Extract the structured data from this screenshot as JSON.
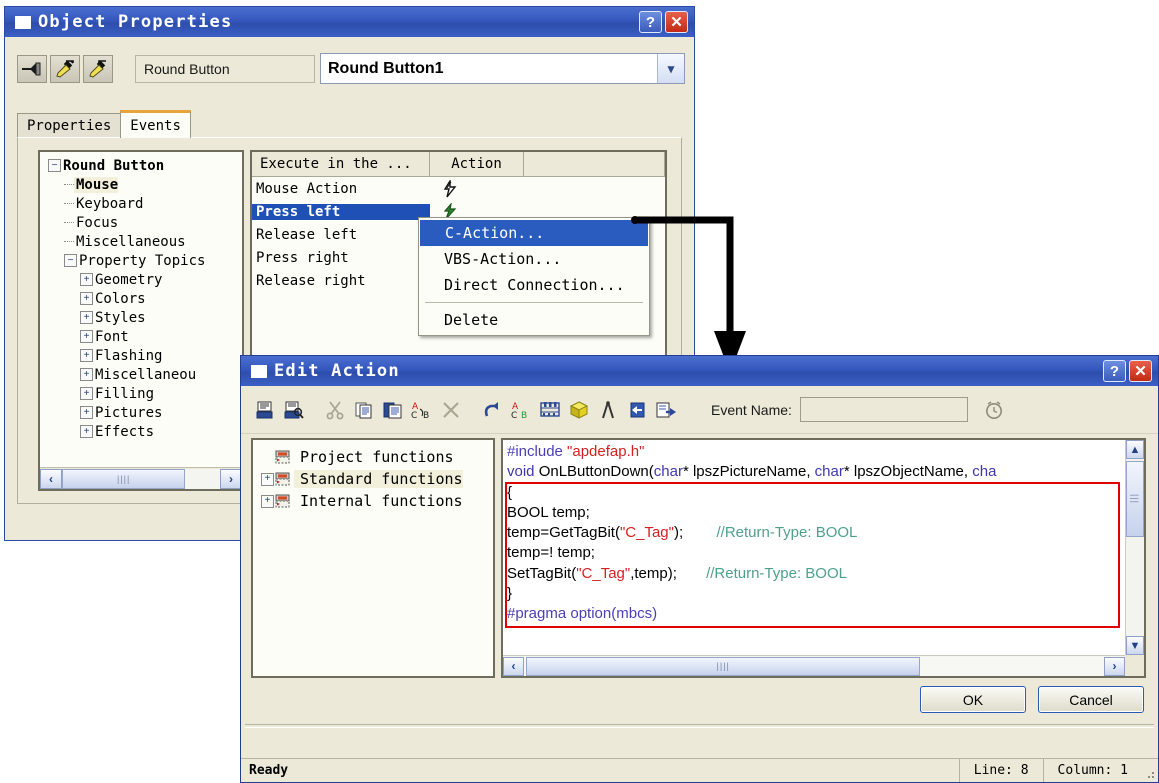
{
  "object_properties": {
    "title": "Object Properties",
    "title_icon": "window-icon",
    "help_label": "?",
    "close_label": "✕",
    "toolbar": [
      {
        "name": "pin-button",
        "icon": "pin-icon"
      },
      {
        "name": "pipette-up-button",
        "icon": "eyedropper-up-icon"
      },
      {
        "name": "pipette-down-button",
        "icon": "eyedropper-down-icon"
      }
    ],
    "object_type_label": "Round Button",
    "object_combo_value": "Round Button1",
    "tabs": [
      {
        "label": "Properties",
        "active": false
      },
      {
        "label": "Events",
        "active": true
      }
    ],
    "tree": [
      {
        "label": "Round Button",
        "indent": 0,
        "toggle": "minus",
        "style": "root"
      },
      {
        "label": "Mouse",
        "indent": 1,
        "toggle": "none",
        "style": "selected"
      },
      {
        "label": "Keyboard",
        "indent": 1,
        "toggle": "none",
        "style": "normal"
      },
      {
        "label": "Focus",
        "indent": 1,
        "toggle": "none",
        "style": "normal"
      },
      {
        "label": "Miscellaneous",
        "indent": 1,
        "toggle": "none",
        "style": "normal"
      },
      {
        "label": "Property Topics",
        "indent": 1,
        "toggle": "minus",
        "style": "normal"
      },
      {
        "label": "Geometry",
        "indent": 2,
        "toggle": "plus",
        "style": "normal"
      },
      {
        "label": "Colors",
        "indent": 2,
        "toggle": "plus",
        "style": "normal"
      },
      {
        "label": "Styles",
        "indent": 2,
        "toggle": "plus",
        "style": "normal"
      },
      {
        "label": "Font",
        "indent": 2,
        "toggle": "plus",
        "style": "normal"
      },
      {
        "label": "Flashing",
        "indent": 2,
        "toggle": "plus",
        "style": "normal"
      },
      {
        "label": "Miscellaneou",
        "indent": 2,
        "toggle": "plus",
        "style": "normal"
      },
      {
        "label": "Filling",
        "indent": 2,
        "toggle": "plus",
        "style": "normal"
      },
      {
        "label": "Pictures",
        "indent": 2,
        "toggle": "plus",
        "style": "normal"
      },
      {
        "label": "Effects",
        "indent": 2,
        "toggle": "plus",
        "style": "normal"
      }
    ],
    "events_columns": [
      "Execute in the ...",
      "Action",
      ""
    ],
    "events_rows": [
      {
        "name": "Mouse Action",
        "selected": false,
        "action_icon": "lightning-black-icon"
      },
      {
        "name": "Press left",
        "selected": true,
        "action_icon": "lightning-green-icon"
      },
      {
        "name": "Release left",
        "selected": false,
        "action_icon": "lightning-small-icon"
      },
      {
        "name": "Press right",
        "selected": false,
        "action_icon": "lightning-small-icon"
      },
      {
        "name": "Release right",
        "selected": false,
        "action_icon": "lightning-small-icon"
      }
    ],
    "context_menu": [
      {
        "label": "C-Action...",
        "highlighted": true,
        "separator_after": false
      },
      {
        "label": "VBS-Action...",
        "highlighted": false,
        "separator_after": false
      },
      {
        "label": "Direct Connection...",
        "highlighted": false,
        "separator_after": true
      },
      {
        "label": "Delete",
        "highlighted": false,
        "separator_after": false
      }
    ],
    "scrollbar": {
      "left_arrow": "‹",
      "right_arrow": "›",
      "grip": "||||"
    }
  },
  "edit_action": {
    "title": "Edit Action",
    "title_icon": "window-icon",
    "help_label": "?",
    "close_label": "✕",
    "toolbar": [
      {
        "name": "save-button",
        "icon": "save-icon"
      },
      {
        "name": "save-preview-button",
        "icon": "save-search-icon"
      },
      {
        "name": "cut-button",
        "icon": "scissors-icon"
      },
      {
        "name": "copy-button",
        "icon": "copy-icon"
      },
      {
        "name": "paste-button",
        "icon": "paste-icon"
      },
      {
        "name": "replace-button",
        "icon": "replace-a-b-icon"
      },
      {
        "name": "delete-button",
        "icon": "x-cross-icon"
      },
      {
        "name": "undo-button",
        "icon": "undo-arrow-icon"
      },
      {
        "name": "find-replace-button",
        "icon": "find-a-c-b-icon"
      },
      {
        "name": "compile-button",
        "icon": "abacus-icon"
      },
      {
        "name": "package-button",
        "icon": "yellow-cube-icon"
      },
      {
        "name": "compass-button",
        "icon": "compass-icon"
      },
      {
        "name": "step-into-button",
        "icon": "arrow-into-icon"
      },
      {
        "name": "step-out-button",
        "icon": "arrow-out-icon"
      }
    ],
    "event_name_label": "Event Name:",
    "event_name_value": "",
    "clock_icon": "alarm-clock-icon",
    "function_tree": [
      {
        "label": "Project functions",
        "toggle": "none",
        "selected": false
      },
      {
        "label": "Standard functions",
        "toggle": "plus",
        "selected": true
      },
      {
        "label": "Internal functions",
        "toggle": "plus",
        "selected": false
      }
    ],
    "code_lines": [
      [
        {
          "t": "#include ",
          "c": "pre"
        },
        {
          "t": "\"apdefap.h\"",
          "c": "str"
        }
      ],
      [
        {
          "t": "void ",
          "c": "kw"
        },
        {
          "t": "OnLButtonDown(",
          "c": "plain"
        },
        {
          "t": "char",
          "c": "kw"
        },
        {
          "t": "* lpszPictureName, ",
          "c": "plain"
        },
        {
          "t": "char",
          "c": "kw"
        },
        {
          "t": "* lpszObjectName, ",
          "c": "plain"
        },
        {
          "t": "cha",
          "c": "kw"
        }
      ],
      [
        {
          "t": "{",
          "c": "plain"
        }
      ],
      [
        {
          "t": "BOOL temp;",
          "c": "plain"
        }
      ],
      [
        {
          "t": "temp=GetTagBit(",
          "c": "plain"
        },
        {
          "t": "\"C_Tag\"",
          "c": "str"
        },
        {
          "t": ");        ",
          "c": "plain"
        },
        {
          "t": "//Return-Type: BOOL",
          "c": "cmt"
        }
      ],
      [
        {
          "t": "temp=! temp;",
          "c": "plain"
        }
      ],
      [
        {
          "t": "SetTagBit(",
          "c": "plain"
        },
        {
          "t": "\"C_Tag\"",
          "c": "str"
        },
        {
          "t": ",temp);       ",
          "c": "plain"
        },
        {
          "t": "//Return-Type: BOOL",
          "c": "cmt"
        }
      ],
      [
        {
          "t": "}",
          "c": "plain"
        }
      ],
      [
        {
          "t": "#pragma option(mbcs)",
          "c": "pre"
        }
      ]
    ],
    "highlight_box_color": "#e00000",
    "buttons": [
      {
        "label": "OK",
        "name": "ok-button"
      },
      {
        "label": "Cancel",
        "name": "cancel-button"
      }
    ],
    "status": {
      "ready": "Ready",
      "line": "Line: 8",
      "column": "Column: 1"
    },
    "scroll": {
      "up": "︿",
      "down": "﹀",
      "left": "‹",
      "right": "›"
    }
  },
  "annotation": {
    "connector": "arrow-from-c-action-to-edit-action"
  }
}
